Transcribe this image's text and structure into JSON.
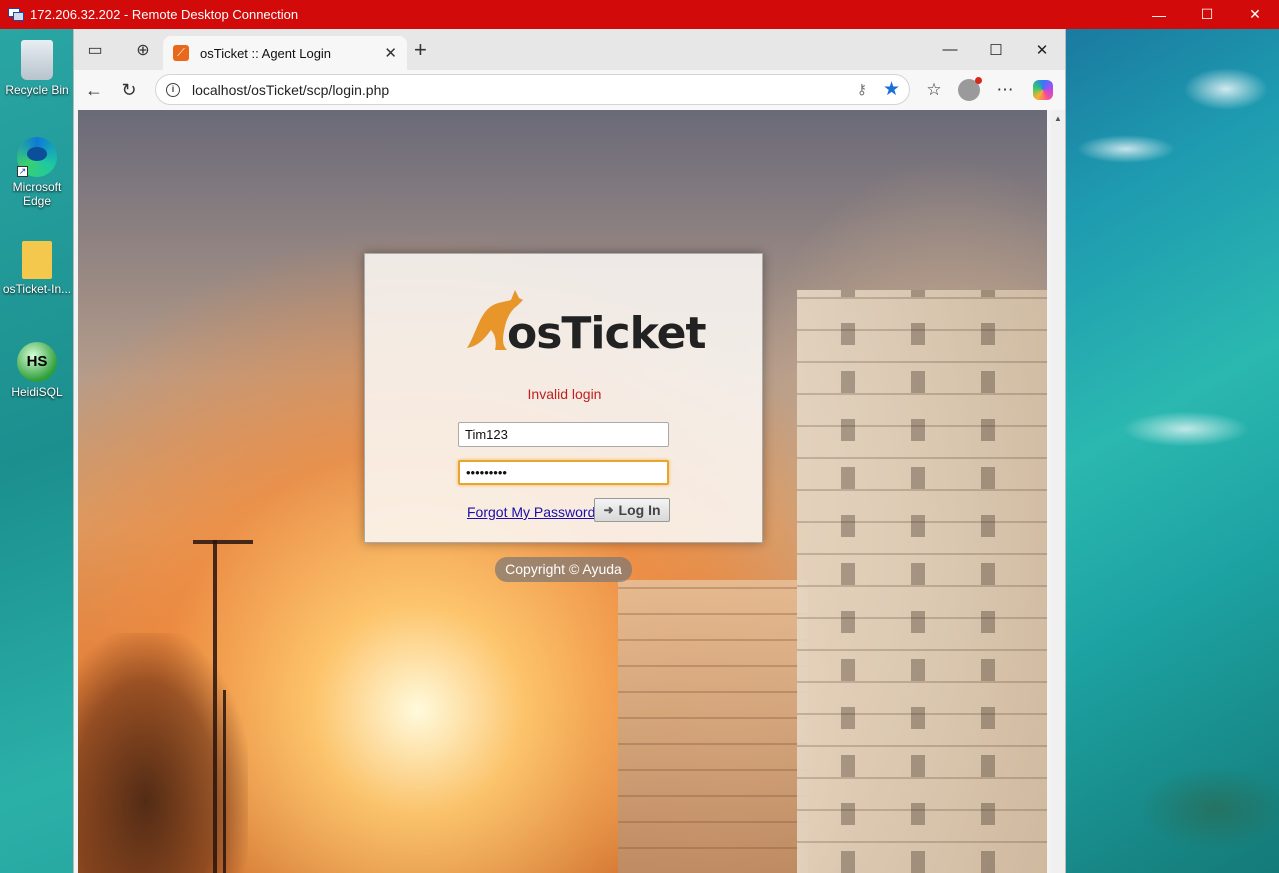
{
  "rdp": {
    "title": "172.206.32.202 - Remote Desktop Connection",
    "minimize": "—",
    "maximize": "☐",
    "close": "✕"
  },
  "desktop": {
    "icons": [
      {
        "label": "Recycle Bin",
        "icon": "recycle-bin-icon"
      },
      {
        "label": "Microsoft Edge",
        "icon": "edge-icon"
      },
      {
        "label": "osTicket-In...",
        "icon": "folder-icon"
      },
      {
        "label": "HeidiSQL",
        "icon": "heidisql-icon",
        "glyph": "HS"
      }
    ]
  },
  "browser": {
    "tab": {
      "title": "osTicket :: Agent Login",
      "close": "✕"
    },
    "new_tab": "+",
    "window": {
      "minimize": "—",
      "maximize": "☐",
      "close": "✕"
    },
    "address": {
      "url": "localhost/osTicket/scp/login.php"
    }
  },
  "page": {
    "logo_text": "osTicket",
    "error": "Invalid login",
    "username": "Tim123",
    "password": "•••••••••",
    "forgot_link": "Forgot My Password",
    "login_button": "Log In",
    "copyright": "Copyright © Ayuda"
  },
  "colors": {
    "rdp_bar": "#d20a0a",
    "error": "#c02020",
    "link": "#1a0dab",
    "focus": "#e8a530",
    "logo": "#e8952a"
  }
}
